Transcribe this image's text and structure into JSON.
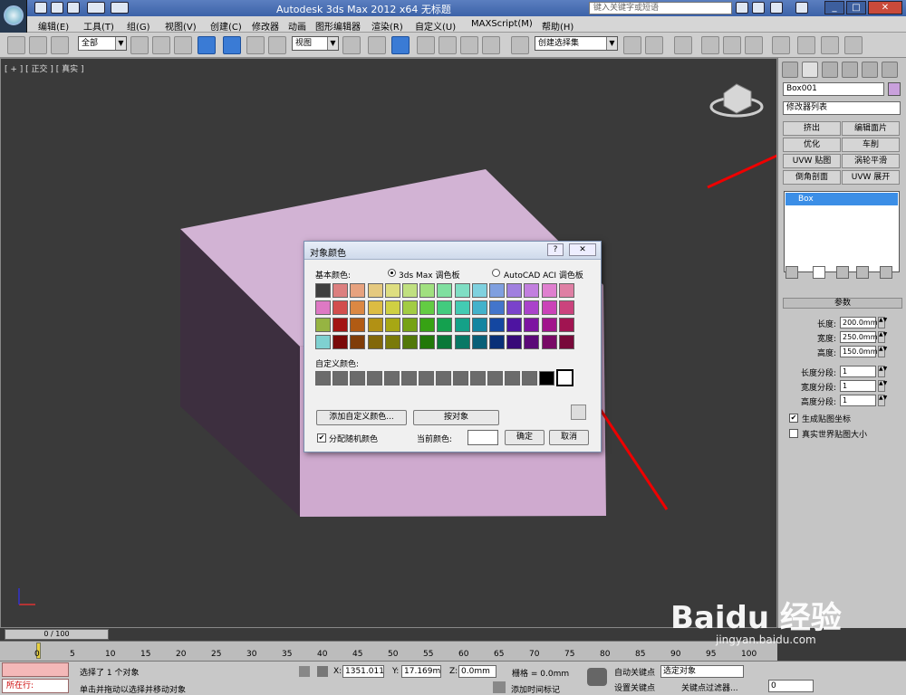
{
  "titlebar": {
    "title": "Autodesk 3ds Max  2012 x64     无标题",
    "search_placeholder": "键入关键字或短语"
  },
  "menu": [
    "编辑(E)",
    "工具(T)",
    "组(G)",
    "视图(V)",
    "创建(C)",
    "修改器",
    "动画",
    "图形编辑器",
    "渲染(R)",
    "自定义(U)",
    "MAXScript(M)",
    "帮助(H)"
  ],
  "toolbar": {
    "selection_filter": "全部",
    "ref_coord": "视图",
    "named_selection": "创建选择集"
  },
  "viewport": {
    "label": "[ + ] [ 正交 ] [ 真实 ]",
    "object_color": "#c8a6cc"
  },
  "panel": {
    "object_name": "Box001",
    "color_swatch": "#c9a0dc",
    "modifier_list": "修改器列表",
    "modifier_buttons": [
      "挤出",
      "编辑面片",
      "优化",
      "车削",
      "UVW 贴图",
      "涡轮平滑",
      "倒角剖面",
      "UVW 展开"
    ],
    "stack_item": "Box",
    "rollout_title": "参数",
    "params": [
      {
        "label": "长度:",
        "value": "200.0mm"
      },
      {
        "label": "宽度:",
        "value": "250.0mm"
      },
      {
        "label": "高度:",
        "value": "150.0mm"
      },
      {
        "label": "长度分段:",
        "value": "1"
      },
      {
        "label": "宽度分段:",
        "value": "1"
      },
      {
        "label": "高度分段:",
        "value": "1"
      }
    ],
    "gen_mapping": "生成贴图坐标",
    "real_world": "真实世界贴图大小"
  },
  "dialog": {
    "title": "对象颜色",
    "help": "?",
    "close": "✕",
    "basic_colors_label": "基本颜色:",
    "palette_max": "3ds Max 调色板",
    "palette_acad": "AutoCAD ACI 调色板",
    "custom_colors_label": "自定义颜色:",
    "add_custom": "添加自定义颜色...",
    "by_object": "按对象",
    "assign_random": "分配随机颜色",
    "current_color_label": "当前颜色:",
    "current_color": "#ffffff",
    "ok": "确定",
    "cancel": "取消",
    "palette": [
      [
        "#3e3e3e",
        "#dc7f7f",
        "#e7a27f",
        "#e5c97f",
        "#dede80",
        "#c0e080",
        "#a0e07f",
        "#7fdf9f",
        "#7fdec4",
        "#7fd1df",
        "#7f9fdf",
        "#a07fdf",
        "#c27fdf",
        "#df7fcf",
        "#df7fa4"
      ],
      [
        "#de79c4",
        "#d24e4e",
        "#db8843",
        "#dcbc43",
        "#cfd043",
        "#a2cc43",
        "#63cc43",
        "#43cb7e",
        "#43cbb3",
        "#43b2cb",
        "#4375cb",
        "#7a43cb",
        "#aa43cb",
        "#cb43b8",
        "#cb437d"
      ],
      [
        "#96b442",
        "#a31414",
        "#b15b14",
        "#b29114",
        "#a7a714",
        "#76a214",
        "#37a214",
        "#14a14f",
        "#14a188",
        "#1485a1",
        "#1447a1",
        "#4e14a1",
        "#7d14a1",
        "#a1148c",
        "#a11451"
      ],
      [
        "#7fd1d1",
        "#7a0909",
        "#803d09",
        "#826709",
        "#7a7a09",
        "#527809",
        "#227809",
        "#097838",
        "#097865",
        "#096078",
        "#093078",
        "#370978",
        "#5b0978",
        "#780966",
        "#78093a"
      ]
    ],
    "custom": [
      "#6b6b6b",
      "#6b6b6b",
      "#6b6b6b",
      "#6b6b6b",
      "#6b6b6b",
      "#6b6b6b",
      "#6b6b6b",
      "#6b6b6b",
      "#6b6b6b",
      "#6b6b6b",
      "#6b6b6b",
      "#6b6b6b",
      "#6b6b6b",
      "#000000",
      "#ffffff"
    ]
  },
  "timeline": {
    "frame": "0 / 100",
    "ticks": [
      "0",
      "5",
      "10",
      "15",
      "20",
      "25",
      "30",
      "35",
      "40",
      "45",
      "50",
      "55",
      "60",
      "65",
      "70",
      "75",
      "80",
      "85",
      "90",
      "95",
      "100"
    ]
  },
  "status": {
    "running": "所在行:",
    "selected": "选择了 1 个对象",
    "prompt": "单击并拖动以选择并移动对象",
    "x_label": "X:",
    "x": "1351.011m",
    "y_label": "Y:",
    "y": "17.169mm",
    "z_label": "Z:",
    "z": "0.0mm",
    "grid": "栅格 = 0.0mm",
    "add_time_tag": "添加时间标记",
    "auto_key": "自动关键点",
    "set_key": "设置关键点",
    "selected_obj": "选定对象",
    "key_filters": "关键点过滤器...",
    "frame": "0"
  },
  "watermark": {
    "brand": "Baidu 经验",
    "url": "jingyan.baidu.com"
  }
}
